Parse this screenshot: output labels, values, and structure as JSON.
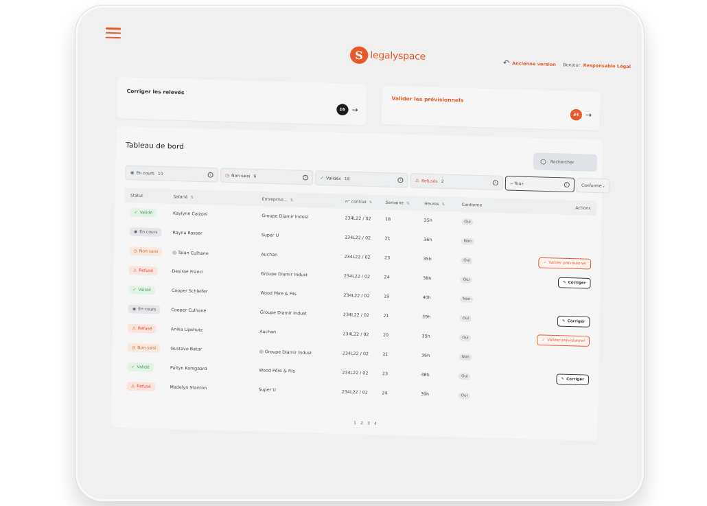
{
  "header": {
    "logo_mark": "S",
    "logo_text": "legalyspace",
    "old_version_label": "Ancienne version",
    "greeting": "Bonjour,",
    "user_role": "Responsable Légal"
  },
  "cards": {
    "fix": {
      "title": "Corriger les relevés",
      "count": "16",
      "arrow": "→"
    },
    "validate": {
      "title": "Valider les prévisionnels",
      "count": "34",
      "arrow": "→"
    }
  },
  "dashboard": {
    "title": "Tableau de bord",
    "search_placeholder": "Rechercher",
    "filters": [
      {
        "label": "En cours",
        "count": "10"
      },
      {
        "label": "Non saisi",
        "count": "6"
      },
      {
        "label": "Validés",
        "count": "18"
      },
      {
        "label": "Refusés",
        "count": "2"
      }
    ],
    "select_value": "-- Tous",
    "conforme_label": "Conforme",
    "columns": [
      "Statut",
      "Salarié",
      "Entreprise...",
      "n° contrat",
      "Semaine",
      "Heures",
      "Conforme",
      "Actions"
    ],
    "rows": [
      {
        "status": "Validé",
        "employee": "Kaylynn Calzoni",
        "company": "Groupe Diamir Indust",
        "contract": "234L22 / 02",
        "week": "18",
        "hours": "35h",
        "conform": "Oui",
        "action": ""
      },
      {
        "status": "En cours",
        "employee": "Rayna Rosser",
        "company": "Super U",
        "contract": "234L22 / 02",
        "week": "21",
        "hours": "36h",
        "conform": "Non",
        "action": ""
      },
      {
        "status": "Non saisi",
        "employee": "Talan Culhane",
        "company": "Auchan",
        "contract": "234L22 / 02",
        "week": "23",
        "hours": "35h",
        "conform": "Oui",
        "action": "Valider prévisionnel"
      },
      {
        "status": "Refusé",
        "employee": "Desirae Franci",
        "company": "Groupe Diamir Indust",
        "contract": "234L22 / 02",
        "week": "24",
        "hours": "38h",
        "conform": "Oui",
        "action": "Corriger"
      },
      {
        "status": "Validé",
        "employee": "Cooper Schleifer",
        "company": "Wood Père & Fils",
        "contract": "234L22 / 02",
        "week": "19",
        "hours": "40h",
        "conform": "Non",
        "action": ""
      },
      {
        "status": "En cours",
        "employee": "Cooper Culhane",
        "company": "Groupe Diamir Indust",
        "contract": "234L22 / 02",
        "week": "21",
        "hours": "39h",
        "conform": "Oui",
        "action": "Corriger"
      },
      {
        "status": "Refusé",
        "employee": "Anika Lipshutz",
        "company": "Auchan",
        "contract": "234L22 / 02",
        "week": "20",
        "hours": "35h",
        "conform": "Oui",
        "action": "Valider prévisionnel"
      },
      {
        "status": "Non saisi",
        "employee": "Gustavo Bator",
        "company": "Groupe Diamir Indust",
        "contract": "234L22 / 02",
        "week": "21",
        "hours": "36h",
        "conform": "Non",
        "action": ""
      },
      {
        "status": "Validé",
        "employee": "Paityn Korsgaard",
        "company": "Wood Père & Fils",
        "contract": "234L22 / 02",
        "week": "23",
        "hours": "38h",
        "conform": "Oui",
        "action": "Corriger"
      },
      {
        "status": "Refusé",
        "employee": "Madelyn Stanton",
        "company": "Super U",
        "contract": "234L22 / 02",
        "week": "24",
        "hours": "39h",
        "conform": "Oui",
        "action": ""
      }
    ],
    "pages": [
      "1",
      "2",
      "3",
      "4"
    ]
  },
  "colors": {
    "accent": "#e8592a",
    "valid": "#3aa35a",
    "refused": "#e0442a",
    "pending": "#c8662a"
  }
}
